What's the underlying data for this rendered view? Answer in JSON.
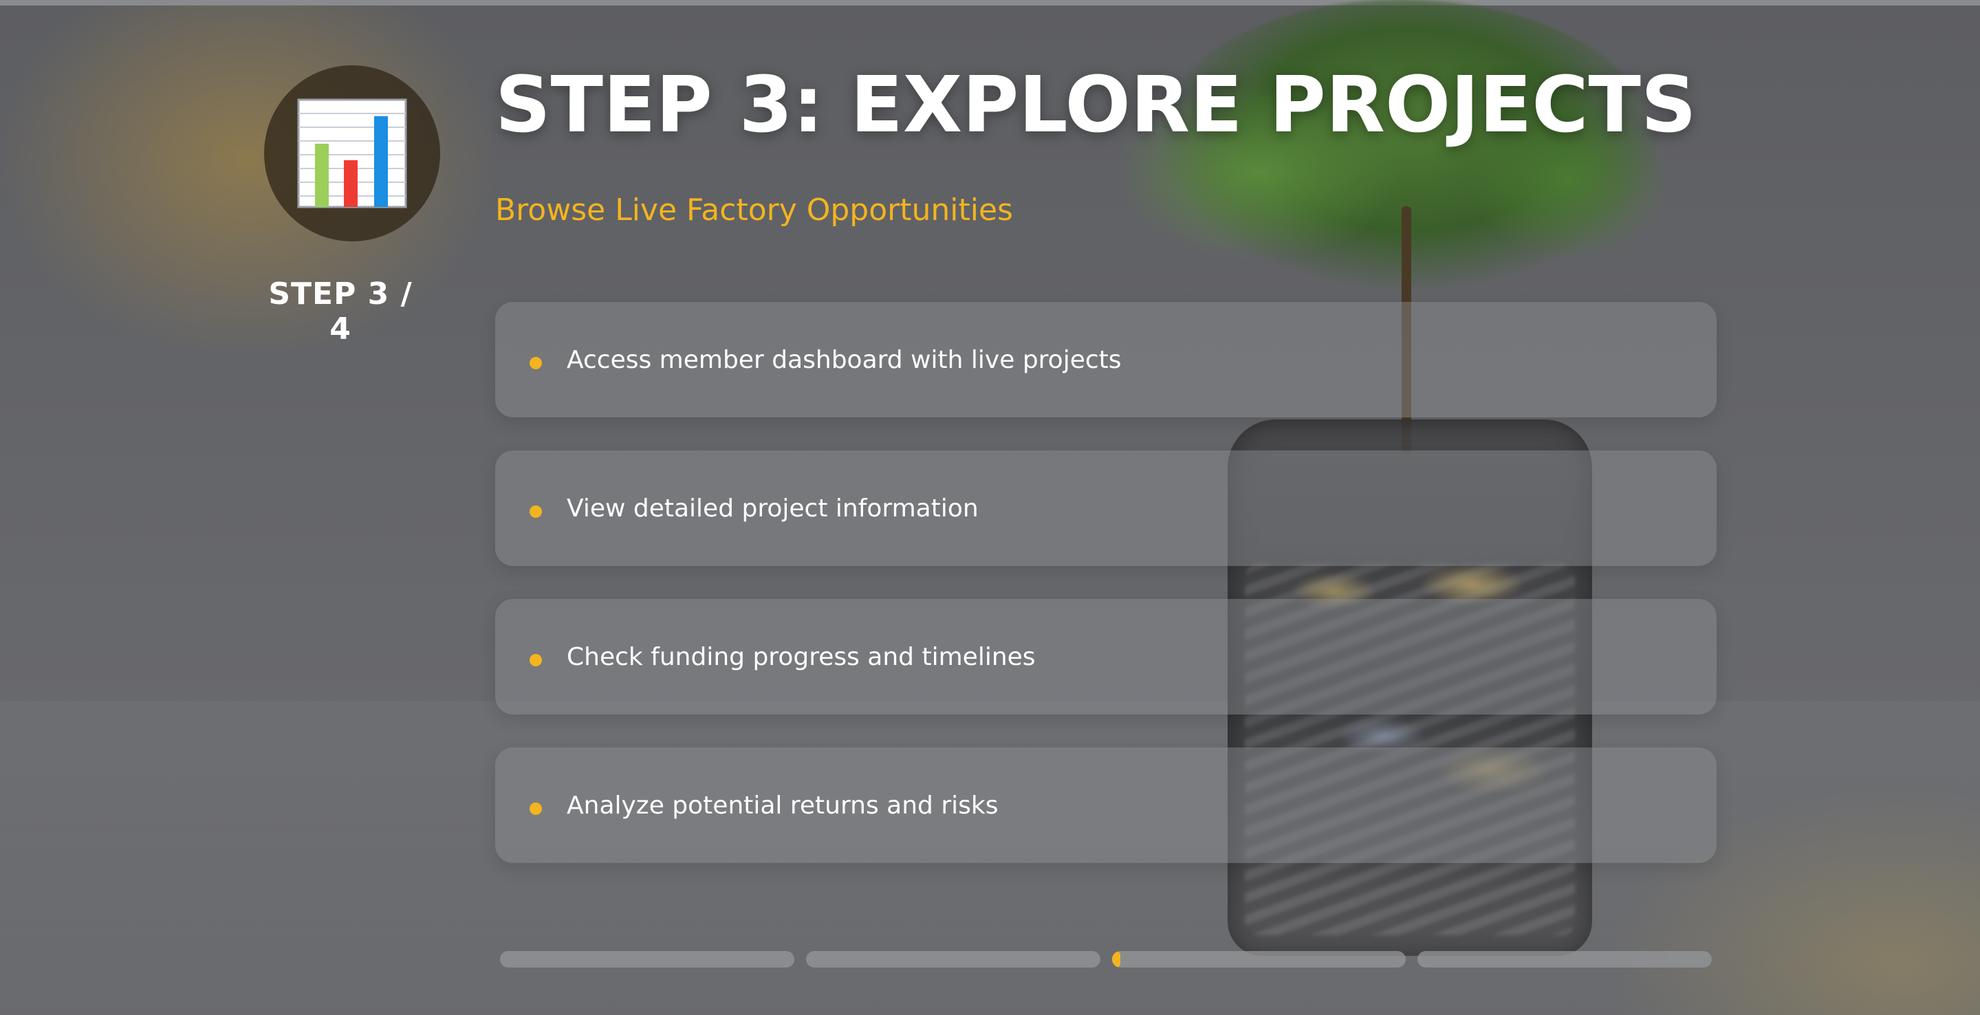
{
  "step": {
    "icon": "bar-chart-icon",
    "counter": "STEP 3 / 4"
  },
  "header": {
    "title": "STEP 3: EXPLORE PROJECTS",
    "subtitle": "Browse Live Factory Opportunities"
  },
  "points": [
    {
      "text": "Access member dashboard with live projects"
    },
    {
      "text": "View detailed project information"
    },
    {
      "text": "Check funding progress and timelines"
    },
    {
      "text": "Analyze potential returns and risks"
    }
  ],
  "progress": {
    "segments": [
      {
        "fill": 0.0
      },
      {
        "fill": 0.0
      },
      {
        "fill": 0.03
      },
      {
        "fill": 0.0
      }
    ]
  },
  "colors": {
    "accent": "#f4b41f",
    "text": "#ffffff"
  }
}
